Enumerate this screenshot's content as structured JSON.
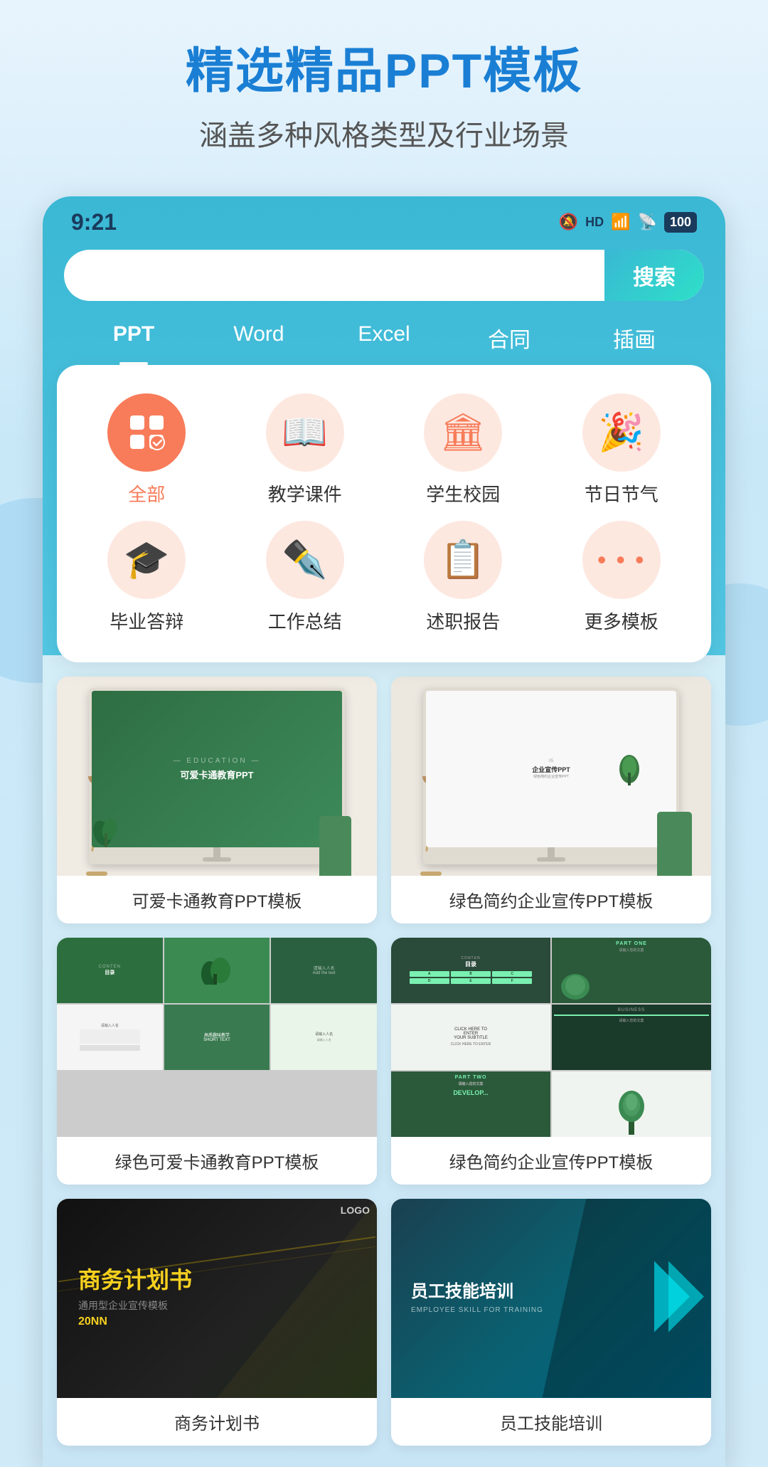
{
  "hero": {
    "title": "精选精品PPT模板",
    "subtitle": "涵盖多种风格类型及行业场景"
  },
  "statusBar": {
    "time": "9:21",
    "battery": "100",
    "signal": "HD"
  },
  "searchBar": {
    "placeholder": "",
    "buttonLabel": "搜索"
  },
  "tabs": [
    {
      "id": "ppt",
      "label": "PPT",
      "active": true
    },
    {
      "id": "word",
      "label": "Word",
      "active": false
    },
    {
      "id": "excel",
      "label": "Excel",
      "active": false
    },
    {
      "id": "hetong",
      "label": "合同",
      "active": false
    },
    {
      "id": "chuhua",
      "label": "插画",
      "active": false
    }
  ],
  "categories": [
    {
      "id": "all",
      "label": "全部",
      "icon": "⊞",
      "active": true
    },
    {
      "id": "teaching",
      "label": "教学课件",
      "icon": "📖",
      "active": false
    },
    {
      "id": "campus",
      "label": "学生校园",
      "icon": "🏛",
      "active": false
    },
    {
      "id": "holiday",
      "label": "节日节气",
      "icon": "🎉",
      "active": false
    },
    {
      "id": "graduation",
      "label": "毕业答辩",
      "icon": "🎓",
      "active": false
    },
    {
      "id": "work",
      "label": "工作总结",
      "icon": "✏",
      "active": false
    },
    {
      "id": "report",
      "label": "述职报告",
      "icon": "📝",
      "active": false
    },
    {
      "id": "more",
      "label": "更多模板",
      "icon": "···",
      "active": false
    }
  ],
  "templates": [
    {
      "id": "green-edu",
      "title": "可爱卡通教育PPT模板",
      "type": "monitor-single",
      "bgColor": "#3a8a52"
    },
    {
      "id": "green-biz",
      "title": "绿色简约企业宣传PPT模板",
      "type": "monitor-single",
      "bgColor": "#f5f5f5"
    },
    {
      "id": "green-edu-collage",
      "title": "绿色可爱卡通教育PPT模板",
      "type": "collage",
      "bgColor": "#3a8a52"
    },
    {
      "id": "green-biz-collage",
      "title": "绿色简约企业宣传PPT模板",
      "type": "collage2",
      "bgColor": "#2a5a3a"
    },
    {
      "id": "dark-biz",
      "title": "商务计划书",
      "type": "dark",
      "bgColor": "#1a1a1a"
    },
    {
      "id": "teal-training",
      "title": "员工技能培训",
      "type": "teal",
      "bgColor": "#006688"
    }
  ],
  "colors": {
    "primary": "#1a7fd4",
    "accent": "#f87c5a",
    "teal": "#3ab8d4",
    "tabGradientStart": "#3ab8d4",
    "tabGradientEnd": "#7ddde8"
  }
}
